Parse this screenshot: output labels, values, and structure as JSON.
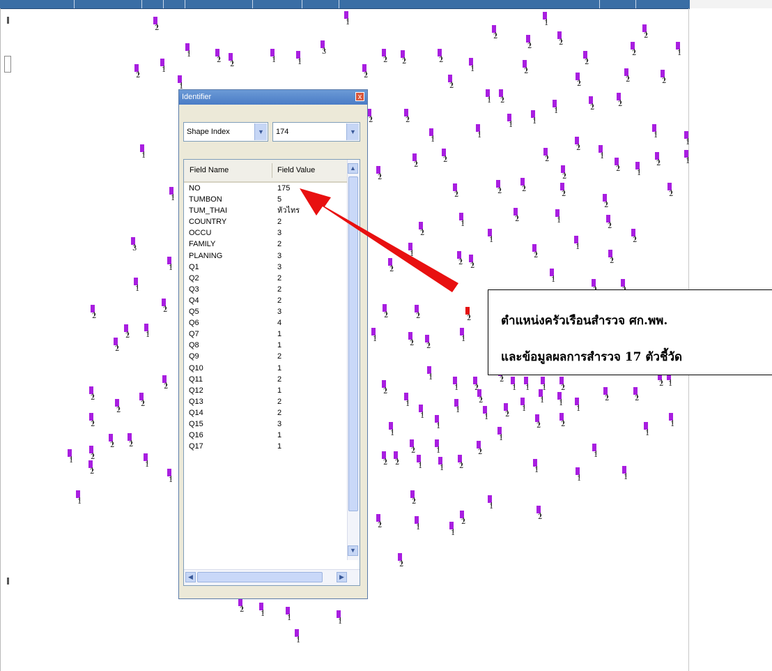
{
  "identifier_window": {
    "title": "Identifier",
    "close_glyph": "x",
    "field_selector": {
      "value": "Shape Index"
    },
    "index_selector": {
      "value": "174"
    },
    "columns": [
      "Field Name",
      "Field Value"
    ],
    "rows": [
      {
        "name": "NO",
        "value": "175"
      },
      {
        "name": "TUMBON",
        "value": "5"
      },
      {
        "name": "TUM_THAI",
        "value": "หัวไทร"
      },
      {
        "name": "COUNTRY",
        "value": "2"
      },
      {
        "name": "OCCU",
        "value": "3"
      },
      {
        "name": "FAMILY",
        "value": "2"
      },
      {
        "name": "PLANING",
        "value": "3"
      },
      {
        "name": "Q1",
        "value": "3"
      },
      {
        "name": "Q2",
        "value": "2"
      },
      {
        "name": "Q3",
        "value": "2"
      },
      {
        "name": "Q4",
        "value": "2"
      },
      {
        "name": "Q5",
        "value": "3"
      },
      {
        "name": "Q6",
        "value": "4"
      },
      {
        "name": "Q7",
        "value": "1"
      },
      {
        "name": "Q8",
        "value": "1"
      },
      {
        "name": "Q9",
        "value": "2"
      },
      {
        "name": "Q10",
        "value": "1"
      },
      {
        "name": "Q11",
        "value": "2"
      },
      {
        "name": "Q12",
        "value": "1"
      },
      {
        "name": "Q13",
        "value": "2"
      },
      {
        "name": "Q14",
        "value": "2"
      },
      {
        "name": "Q15",
        "value": "3"
      },
      {
        "name": "Q16",
        "value": "1"
      },
      {
        "name": "Q17",
        "value": "1"
      }
    ]
  },
  "callout": {
    "line1": "ตำแหน่งครัวเรือนสำรวจ ศก.พพ.",
    "line2": "และข้อมูลผลการสำรวจ 17 ตัวชี้วัด"
  },
  "map": {
    "point_color": "#a81ee0",
    "selected_color": "#e41010",
    "points": [
      [
        "2",
        220,
        24
      ],
      [
        "1",
        494,
        16
      ],
      [
        "1",
        779,
        17
      ],
      [
        "2",
        706,
        36
      ],
      [
        "2",
        800,
        45
      ],
      [
        "2",
        755,
        50
      ],
      [
        "2",
        922,
        35
      ],
      [
        "2",
        905,
        60
      ],
      [
        "1",
        970,
        60
      ],
      [
        "1",
        266,
        62
      ],
      [
        "2",
        309,
        70
      ],
      [
        "2",
        328,
        76
      ],
      [
        "1",
        388,
        70
      ],
      [
        "1",
        425,
        73
      ],
      [
        "3",
        460,
        58
      ],
      [
        "2",
        548,
        70
      ],
      [
        "2",
        575,
        72
      ],
      [
        "2",
        628,
        70
      ],
      [
        "1",
        673,
        83
      ],
      [
        "2",
        750,
        86
      ],
      [
        "2",
        837,
        73
      ],
      [
        "2",
        193,
        92
      ],
      [
        "1",
        230,
        84
      ],
      [
        "1",
        255,
        108
      ],
      [
        "2",
        520,
        92
      ],
      [
        "2",
        643,
        107
      ],
      [
        "2",
        896,
        98
      ],
      [
        "2",
        826,
        104
      ],
      [
        "2",
        948,
        100
      ],
      [
        "1",
        697,
        128
      ],
      [
        "2",
        716,
        128
      ],
      [
        "1",
        793,
        143
      ],
      [
        "2",
        845,
        138
      ],
      [
        "2",
        885,
        133
      ],
      [
        "2",
        527,
        156
      ],
      [
        "2",
        580,
        156
      ],
      [
        "1",
        762,
        158
      ],
      [
        "1",
        728,
        163
      ],
      [
        "1",
        683,
        178
      ],
      [
        "1",
        616,
        184
      ],
      [
        "1",
        936,
        178
      ],
      [
        "1",
        982,
        188
      ],
      [
        "1",
        201,
        207
      ],
      [
        "2",
        825,
        196
      ],
      [
        "1",
        859,
        208
      ],
      [
        "2",
        780,
        212
      ],
      [
        "2",
        592,
        220
      ],
      [
        "2",
        634,
        213
      ],
      [
        "2",
        882,
        226
      ],
      [
        "2",
        940,
        218
      ],
      [
        "1",
        912,
        232
      ],
      [
        "1",
        982,
        215
      ],
      [
        "2",
        805,
        237
      ],
      [
        "2",
        540,
        238
      ],
      [
        "1",
        243,
        268
      ],
      [
        "2",
        650,
        263
      ],
      [
        "2",
        712,
        258
      ],
      [
        "2",
        747,
        255
      ],
      [
        "2",
        804,
        262
      ],
      [
        "2",
        958,
        262
      ],
      [
        "2",
        865,
        278
      ],
      [
        "1",
        659,
        305
      ],
      [
        "2",
        737,
        298
      ],
      [
        "1",
        797,
        300
      ],
      [
        "2",
        870,
        308
      ],
      [
        "2",
        601,
        318
      ],
      [
        "2",
        906,
        328
      ],
      [
        "1",
        700,
        328
      ],
      [
        "1",
        824,
        338
      ],
      [
        "3",
        188,
        340
      ],
      [
        "1",
        240,
        368
      ],
      [
        "1",
        586,
        348
      ],
      [
        "2",
        764,
        350
      ],
      [
        "2",
        673,
        365
      ],
      [
        "2",
        873,
        358
      ],
      [
        "2",
        557,
        370
      ],
      [
        "2",
        656,
        360
      ],
      [
        "1",
        192,
        398
      ],
      [
        "2",
        232,
        428
      ],
      [
        "1",
        789,
        385
      ],
      [
        "2",
        849,
        400
      ],
      [
        "2",
        891,
        400
      ],
      [
        "2",
        130,
        437
      ],
      [
        "2",
        549,
        436
      ],
      [
        "2",
        595,
        437
      ],
      [
        "2",
        178,
        465
      ],
      [
        "1",
        207,
        464
      ],
      [
        "2",
        586,
        476
      ],
      [
        "2",
        610,
        480
      ],
      [
        "1",
        660,
        470
      ],
      [
        "2",
        163,
        484
      ],
      [
        "1",
        533,
        470
      ],
      [
        "2",
        233,
        538
      ],
      [
        "1",
        613,
        525
      ],
      [
        "2",
        548,
        545
      ],
      [
        "1",
        650,
        540
      ],
      [
        "2",
        679,
        540
      ],
      [
        "2",
        715,
        528
      ],
      [
        "1",
        733,
        540
      ],
      [
        "1",
        752,
        540
      ],
      [
        "1",
        776,
        540
      ],
      [
        "2",
        803,
        540
      ],
      [
        "2",
        866,
        555
      ],
      [
        "2",
        909,
        555
      ],
      [
        "2",
        944,
        534
      ],
      [
        "1",
        957,
        534
      ],
      [
        "2",
        128,
        554
      ],
      [
        "2",
        165,
        572
      ],
      [
        "2",
        200,
        563
      ],
      [
        "1",
        580,
        563
      ],
      [
        "2",
        685,
        558
      ],
      [
        "1",
        773,
        558
      ],
      [
        "1",
        800,
        562
      ],
      [
        "1",
        601,
        580
      ],
      [
        "1",
        652,
        572
      ],
      [
        "1",
        693,
        582
      ],
      [
        "2",
        723,
        578
      ],
      [
        "1",
        747,
        570
      ],
      [
        "1",
        825,
        570
      ],
      [
        "2",
        128,
        592
      ],
      [
        "1",
        624,
        595
      ],
      [
        "2",
        768,
        594
      ],
      [
        "2",
        803,
        592
      ],
      [
        "1",
        924,
        605
      ],
      [
        "1",
        960,
        592
      ],
      [
        "2",
        156,
        622
      ],
      [
        "2",
        183,
        621
      ],
      [
        "1",
        558,
        605
      ],
      [
        "1",
        714,
        612
      ],
      [
        "2",
        128,
        639
      ],
      [
        "1",
        97,
        644
      ],
      [
        "1",
        850,
        636
      ],
      [
        "2",
        127,
        660
      ],
      [
        "1",
        206,
        650
      ],
      [
        "2",
        548,
        647
      ],
      [
        "2",
        565,
        647
      ],
      [
        "2",
        588,
        630
      ],
      [
        "1",
        598,
        652
      ],
      [
        "1",
        624,
        630
      ],
      [
        "1",
        629,
        655
      ],
      [
        "2",
        657,
        652
      ],
      [
        "2",
        684,
        632
      ],
      [
        "1",
        240,
        672
      ],
      [
        "1",
        765,
        658
      ],
      [
        "1",
        826,
        670
      ],
      [
        "1",
        893,
        668
      ],
      [
        "1",
        109,
        703
      ],
      [
        "2",
        589,
        703
      ],
      [
        "1",
        700,
        710
      ],
      [
        "2",
        770,
        725
      ],
      [
        "2",
        540,
        737
      ],
      [
        "1",
        595,
        740
      ],
      [
        "2",
        660,
        732
      ],
      [
        "1",
        645,
        748
      ],
      [
        "2",
        571,
        793
      ],
      [
        "2",
        342,
        858
      ],
      [
        "1",
        372,
        864
      ],
      [
        "1",
        410,
        870
      ],
      [
        "1",
        483,
        875
      ],
      [
        "1",
        423,
        902
      ]
    ],
    "selected_point": [
      "2",
      668,
      440
    ]
  }
}
